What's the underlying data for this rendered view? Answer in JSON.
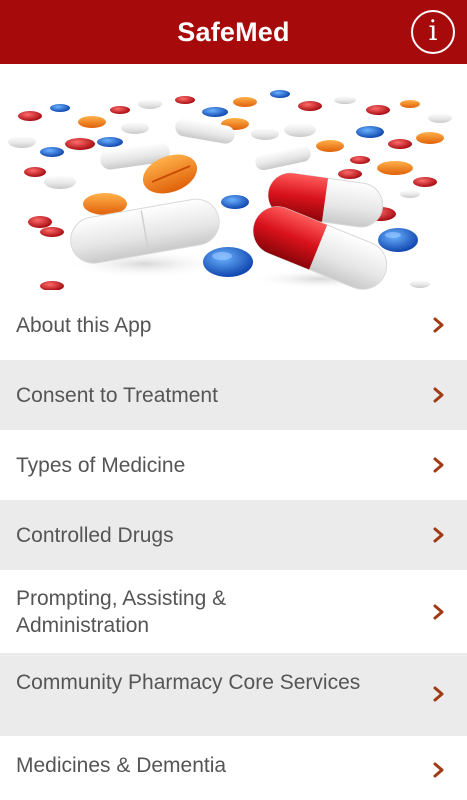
{
  "header": {
    "title": "SafeMed",
    "info_icon": "info-icon",
    "background": "#a70a0a"
  },
  "hero": {
    "image_name": "pills-image"
  },
  "menu": {
    "chevron_color": "#a13a12",
    "items": [
      {
        "label": "About this App"
      },
      {
        "label": "Consent to Treatment"
      },
      {
        "label": "Types of Medicine"
      },
      {
        "label": "Controlled Drugs"
      },
      {
        "label": "Prompting, Assisting & Administration"
      },
      {
        "label": "Community Pharmacy Core Services"
      },
      {
        "label": "Medicines & Dementia"
      }
    ]
  }
}
